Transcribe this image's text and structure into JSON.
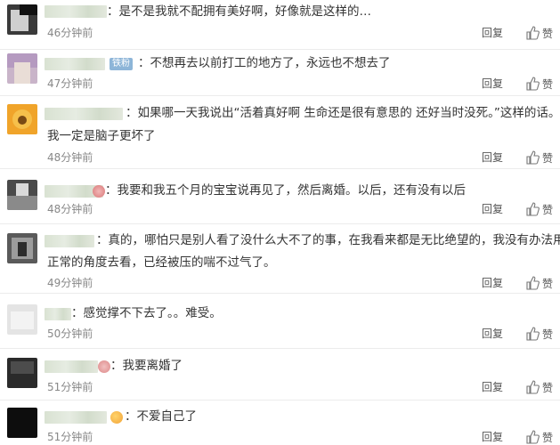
{
  "comments": [
    {
      "text_lines": [
        "：是不是我就不配拥有美好啊，好像就是这样的…"
      ],
      "time": "46分钟前",
      "reply_label": "回复",
      "like_label": "赞"
    },
    {
      "badge": "铁粉",
      "text_lines": [
        "：不想再去以前打工的地方了，永远也不想去了"
      ],
      "time": "47分钟前",
      "reply_label": "回复",
      "like_label": "赞"
    },
    {
      "text_lines": [
        "：如果哪一天我说出“活着真好啊 生命还是很有意思的 还好当时没死。”这样的话。",
        "我一定是脑子更坏了"
      ],
      "time": "48分钟前",
      "reply_label": "回复",
      "like_label": "赞"
    },
    {
      "text_lines": [
        "：我要和我五个月的宝宝说再见了，然后离婚。以后，还有没有以后"
      ],
      "time": "48分钟前",
      "reply_label": "回复",
      "like_label": "赞"
    },
    {
      "text_lines": [
        "：真的，哪怕只是别人看了没什么大不了的事，在我看来都是无比绝望的，我没有办法用",
        "正常的角度去看，已经被压的喘不过气了。"
      ],
      "time": "49分钟前",
      "reply_label": "回复",
      "like_label": "赞"
    },
    {
      "text_lines": [
        "：感觉撑不下去了。。难受。"
      ],
      "time": "50分钟前",
      "reply_label": "回复",
      "like_label": "赞"
    },
    {
      "text_lines": [
        "：我要离婚了"
      ],
      "time": "51分钟前",
      "reply_label": "回复",
      "like_label": "赞"
    },
    {
      "text_lines": [
        "：不爱自己了"
      ],
      "time": "51分钟前",
      "reply_label": "回复",
      "like_label": "赞"
    }
  ]
}
